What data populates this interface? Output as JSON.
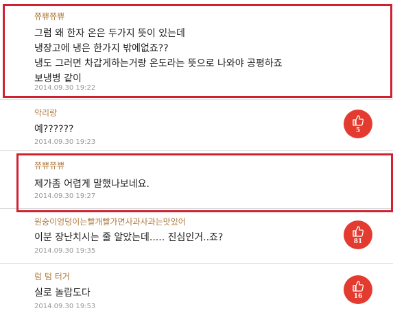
{
  "comments": [
    {
      "author": "쮸쀼쮸쀼",
      "lines": [
        "그럼 왜 한자 온은 두가지 뜻이 있는데",
        "냉장고에 냉은 한가지 밖에없죠??",
        "냉도 그러면 차갑게하는거랑 온도라는 뜻으로 나와야 공평하죠",
        "보냉병 같이"
      ],
      "time": "2014.09.30 19:22"
    },
    {
      "author": "악리랑",
      "lines": [
        "예??????"
      ],
      "time": "2014.09.30 19:23",
      "likes": "5"
    },
    {
      "author": "쮸쀼쮸쀼",
      "lines": [
        "제가좀 어렵게 말했나보네요."
      ],
      "time": "2014.09.30 19:27"
    },
    {
      "author": "원숭이엉덩이는빨개빨가면사과사과는맛있어",
      "lines": [
        "이분 장난치시는 줄 알았는데..... 진심인거..죠?"
      ],
      "time": "2014.09.30 19:35",
      "likes": "81"
    },
    {
      "author": "럼 텀 터거",
      "lines": [
        "실로 놀랍도다"
      ],
      "time": "2014.09.30 19:53",
      "likes": "16"
    }
  ],
  "colors": {
    "author": "#b27b3c",
    "highlight": "#d1202f",
    "like_button": "#e33b2f"
  },
  "icons": {
    "like": "thumbs-up-icon"
  }
}
